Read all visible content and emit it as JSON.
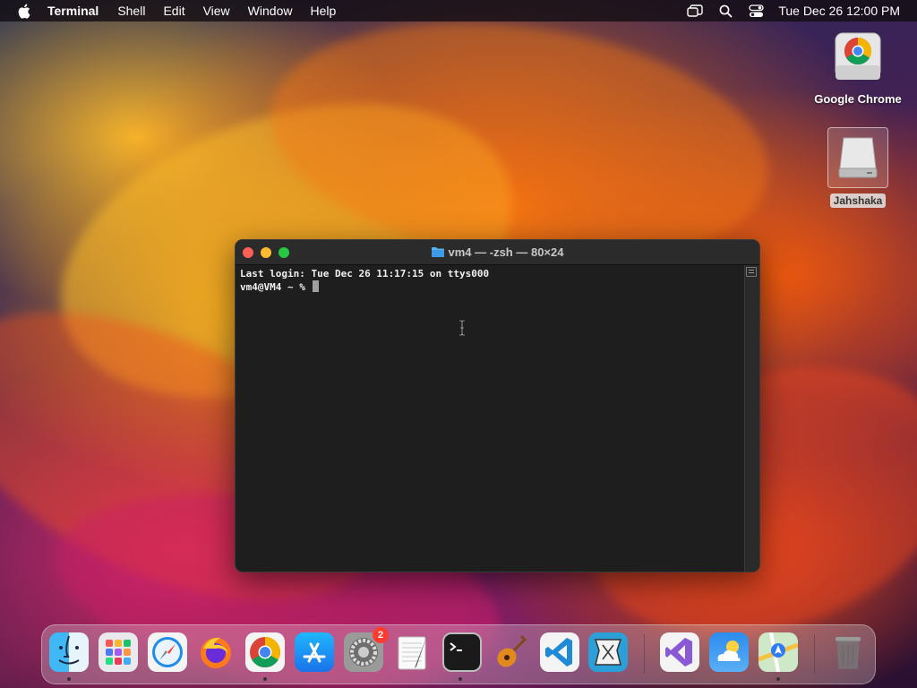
{
  "menubar": {
    "app_name": "Terminal",
    "items": [
      "Shell",
      "Edit",
      "View",
      "Window",
      "Help"
    ],
    "clock": "Tue Dec 26  12:00 PM",
    "icons": [
      "apple-icon",
      "stage-manager-icon",
      "spotlight-search-icon",
      "control-center-icon"
    ]
  },
  "desktop": {
    "icons": [
      {
        "label": "Google Chrome",
        "icon": "chrome-icon"
      },
      {
        "label": "Jahshaka",
        "icon": "external-drive-icon"
      }
    ]
  },
  "terminal": {
    "title": "vm4 — -zsh — 80×24",
    "lines": [
      "Last login: Tue Dec 26 11:17:15 on ttys000",
      "vm4@VM4 ~ % "
    ]
  },
  "dock": {
    "items": [
      {
        "name": "Finder",
        "icon": "finder-icon",
        "running": true
      },
      {
        "name": "Launchpad",
        "icon": "launchpad-icon",
        "running": false
      },
      {
        "name": "Safari",
        "icon": "safari-icon",
        "running": false
      },
      {
        "name": "Firefox",
        "icon": "firefox-icon",
        "running": false
      },
      {
        "name": "Google Chrome",
        "icon": "chrome-icon",
        "running": true
      },
      {
        "name": "App Store",
        "icon": "app-store-icon",
        "running": false
      },
      {
        "name": "System Settings",
        "icon": "settings-icon",
        "running": false,
        "badge": "2"
      },
      {
        "name": "TextEdit",
        "icon": "textedit-icon",
        "running": false
      },
      {
        "name": "Terminal",
        "icon": "terminal-icon",
        "running": true
      },
      {
        "name": "GarageBand",
        "icon": "guitar-icon",
        "running": false
      },
      {
        "name": "Visual Studio Code",
        "icon": "vscode-icon",
        "running": false
      },
      {
        "name": "Jahshaka",
        "icon": "jahshaka-icon",
        "running": false
      },
      {
        "name": "Visual Studio",
        "icon": "visual-studio-icon",
        "running": false
      },
      {
        "name": "Weather",
        "icon": "weather-icon",
        "running": false
      },
      {
        "name": "Maps",
        "icon": "maps-icon",
        "running": true
      },
      {
        "name": "Trash",
        "icon": "trash-icon",
        "running": false
      }
    ]
  }
}
